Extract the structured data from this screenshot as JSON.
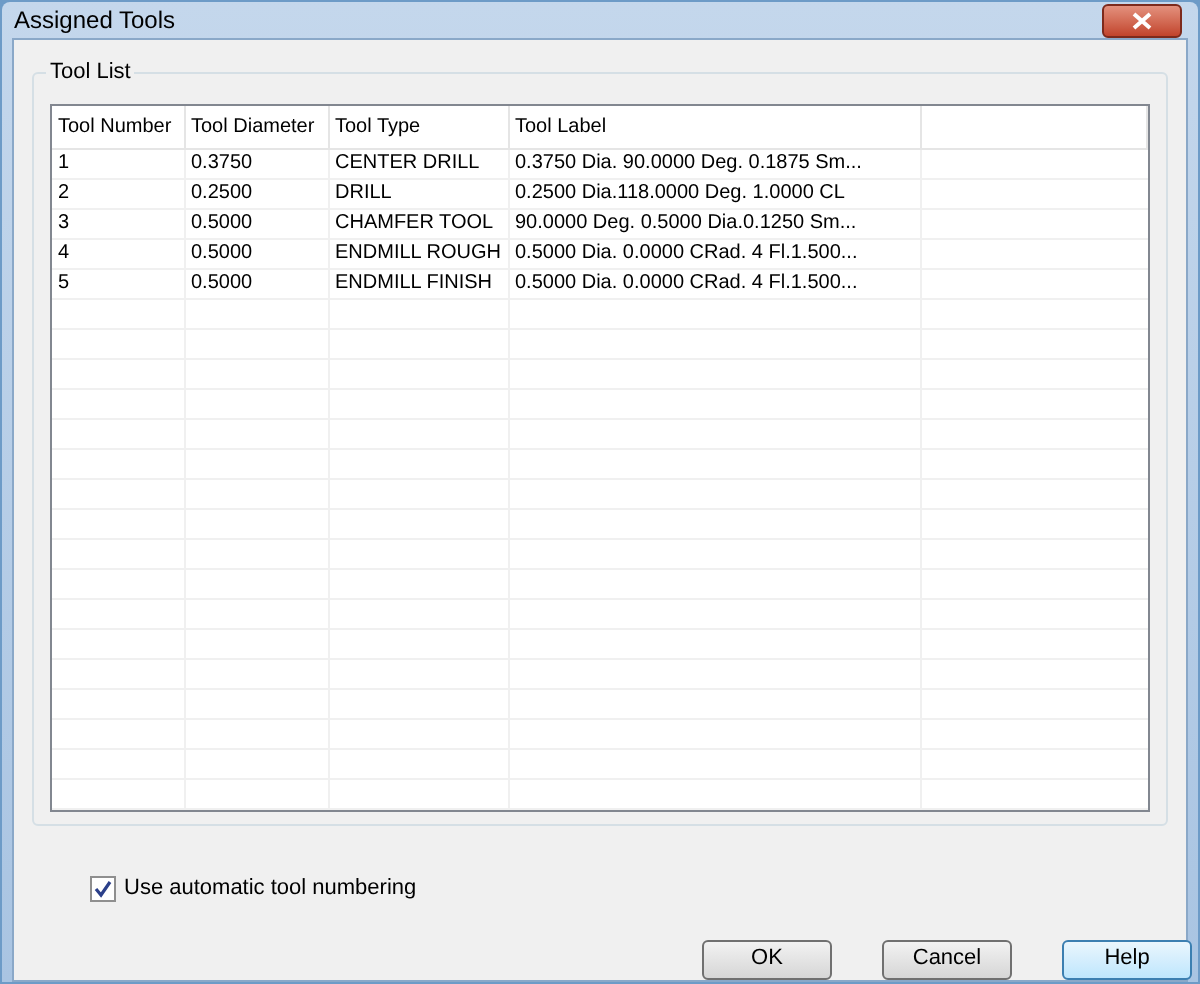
{
  "window": {
    "title": "Assigned Tools"
  },
  "group": {
    "title": "Tool List"
  },
  "table": {
    "columns": [
      "Tool Number",
      "Tool Diameter",
      "Tool Type",
      "Tool Label"
    ],
    "rows": [
      [
        "1",
        "0.3750",
        "CENTER DRILL",
        "0.3750 Dia. 90.0000 Deg. 0.1875 Sm..."
      ],
      [
        "2",
        "0.2500",
        "DRILL",
        "0.2500 Dia.118.0000 Deg. 1.0000 CL"
      ],
      [
        "3",
        "0.5000",
        "CHAMFER TOOL",
        "90.0000 Deg. 0.5000 Dia.0.1250 Sm..."
      ],
      [
        "4",
        "0.5000",
        "ENDMILL ROUGH",
        "0.5000 Dia. 0.0000 CRad. 4 Fl.1.500..."
      ],
      [
        "5",
        "0.5000",
        "ENDMILL FINISH",
        "0.5000 Dia. 0.0000 CRad. 4 Fl.1.500..."
      ]
    ]
  },
  "auto_numbering": {
    "label": "Use automatic tool numbering",
    "checked": true
  },
  "buttons": [
    {
      "label": "OK",
      "focused": false
    },
    {
      "label": "Cancel",
      "focused": false
    },
    {
      "label": "Help",
      "focused": true
    }
  ]
}
